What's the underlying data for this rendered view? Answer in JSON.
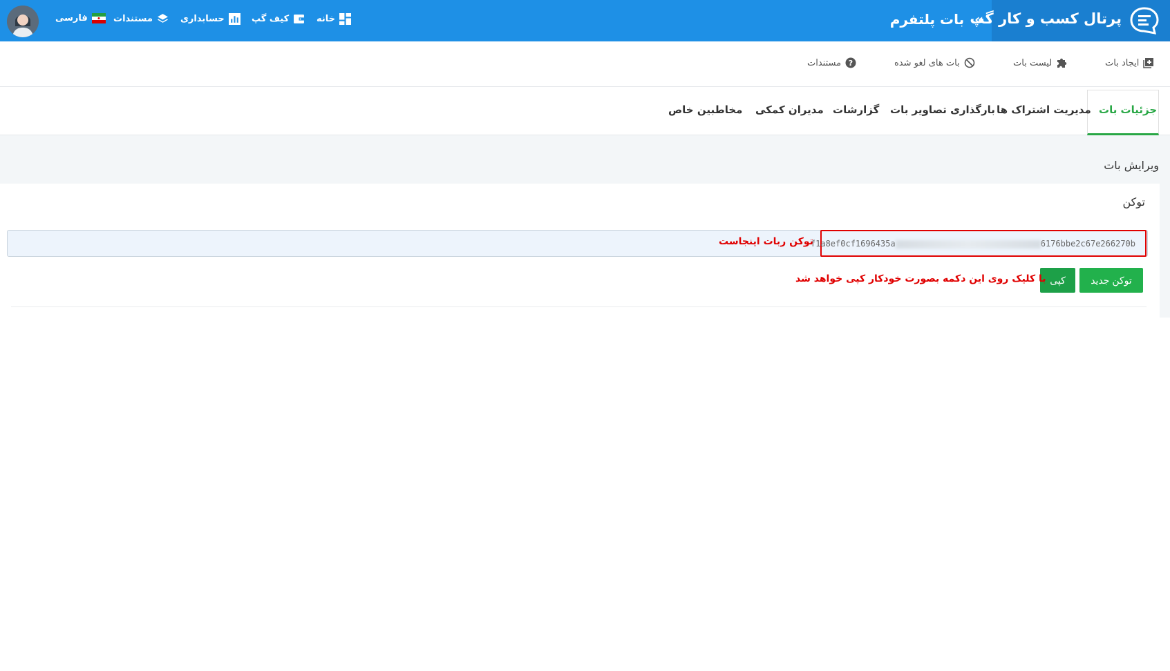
{
  "header": {
    "brand_title": "پرتال کسب و کار گپ",
    "breadcrumb_sep": "»",
    "breadcrumb": "بات پلتفرم",
    "nav": [
      {
        "label": "خانه",
        "icon": "dashboard-icon"
      },
      {
        "label": "کیف گپ",
        "icon": "wallet-icon"
      },
      {
        "label": "حسابداری",
        "icon": "bar-chart-icon"
      },
      {
        "label": "مستندات",
        "icon": "layers-icon"
      },
      {
        "label": "فارسی",
        "icon": "iran-flag-icon"
      }
    ]
  },
  "toolbar": {
    "items": [
      {
        "label": "ایجاد بات",
        "icon": "add-box-icon"
      },
      {
        "label": "لیست بات",
        "icon": "puzzle-icon"
      },
      {
        "label": "بات های لغو شده",
        "icon": "ban-icon"
      },
      {
        "label": "مستندات",
        "icon": "help-circle-icon"
      }
    ]
  },
  "tabs": [
    {
      "label": "جزئیات بات",
      "active": true
    },
    {
      "label": "مدیریت اشتراک ها"
    },
    {
      "label": "بارگذاری تصاویر بات"
    },
    {
      "label": "گزارشات"
    },
    {
      "label": "مدیران کمکی"
    },
    {
      "label": "مخاطبین خاص"
    }
  ],
  "section": {
    "title": "ویرایش بات",
    "token_label": "توکن",
    "token_start": "f1a8ef0cf1696435a",
    "token_end": "6176bbe2c67e266270b",
    "token_annotation": "توکن ربات اینجاست",
    "new_token_button": "توکن جدید",
    "copy_button": "کپی",
    "copy_annotation": "با کلیک روی این دکمه بصورت خودکار کپی خواهد شد"
  },
  "colors": {
    "header_bg": "#1e90e6",
    "brand_bg": "#1a7fd0",
    "active_tab": "#28a745",
    "button_green": "#22b14c",
    "annotation_red": "#e00000"
  }
}
